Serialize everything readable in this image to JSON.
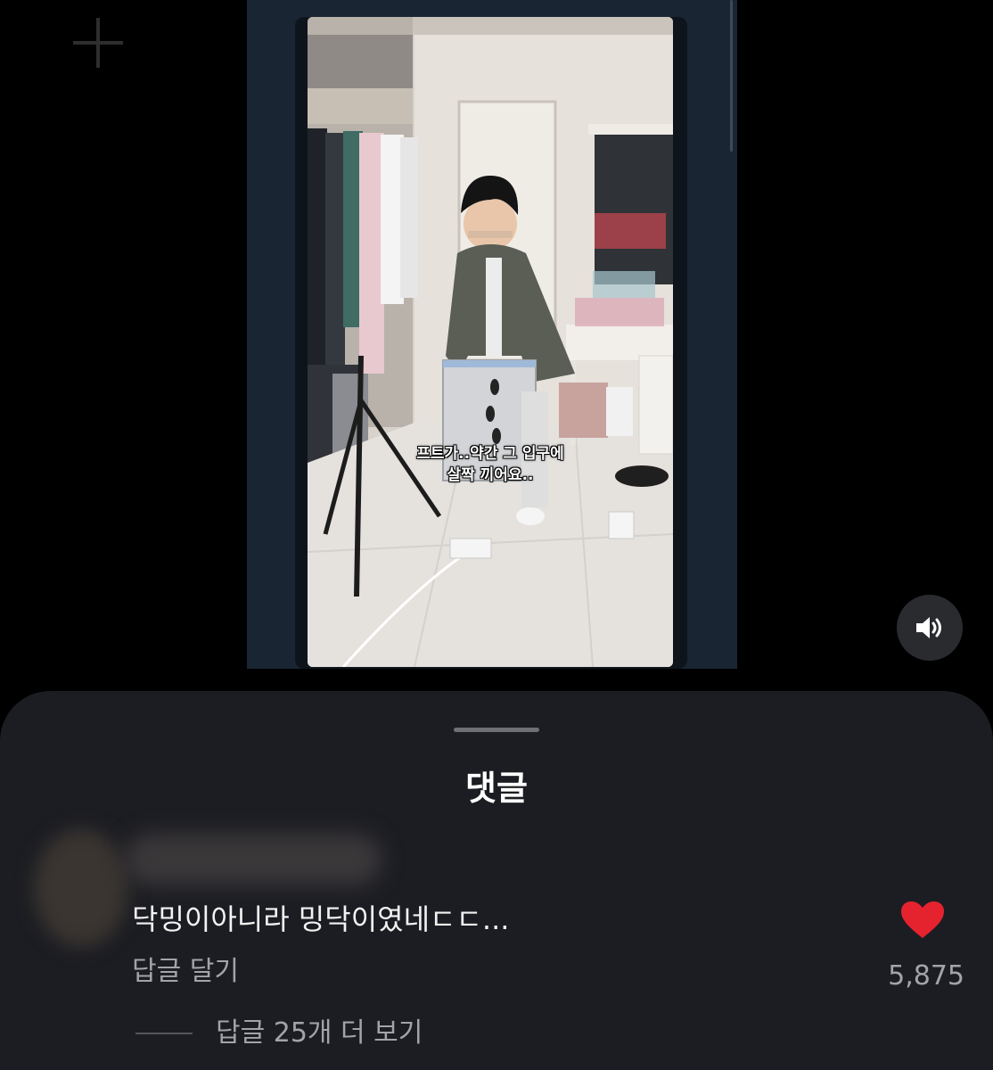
{
  "video": {
    "caption_line1": "프트가..약간 그 입구에",
    "caption_line2": "살짝 끼어요.."
  },
  "icons": {
    "plus": "plus-icon",
    "volume": "volume-icon",
    "like": "heart-icon"
  },
  "colors": {
    "like": "#e5232f",
    "sheet_background": "#1c1d22",
    "secondary_text": "#a3a3a8"
  },
  "comments_sheet": {
    "title": "댓글",
    "comment": {
      "text": "닥밍이아니라 밍닥이였네ㄷㄷ...",
      "reply_label": "답글 달기",
      "like_count": "5,875",
      "more_replies_label": "답글 25개 더 보기"
    }
  }
}
